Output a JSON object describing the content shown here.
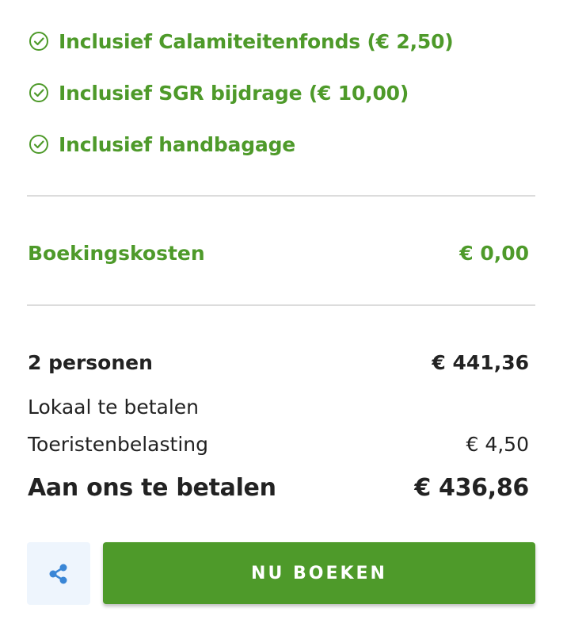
{
  "colors": {
    "accent_green": "#4e9a2a",
    "text_dark": "#222222",
    "divider": "#dcdcdc",
    "share_bg": "#eef5fd",
    "share_icon": "#3a86d6"
  },
  "inclusions": [
    {
      "icon": "check-circle-icon",
      "label": "Inclusief Calamiteitenfonds (€ 2,50)"
    },
    {
      "icon": "check-circle-icon",
      "label": "Inclusief SGR bijdrage (€ 10,00)"
    },
    {
      "icon": "check-circle-icon",
      "label": "Inclusief handbagage"
    }
  ],
  "booking_costs": {
    "label": "Boekingskosten",
    "value": "€ 0,00"
  },
  "summary": {
    "persons_label": "2 personen",
    "persons_value": "€ 441,36",
    "local_pay_label": "Lokaal te betalen",
    "tourist_tax_label": "Toeristenbelasting",
    "tourist_tax_value": "€ 4,50",
    "total_label": "Aan ons te betalen",
    "total_value": "€ 436,86"
  },
  "actions": {
    "share_icon": "share-icon",
    "book_label": "NU BOEKEN"
  }
}
